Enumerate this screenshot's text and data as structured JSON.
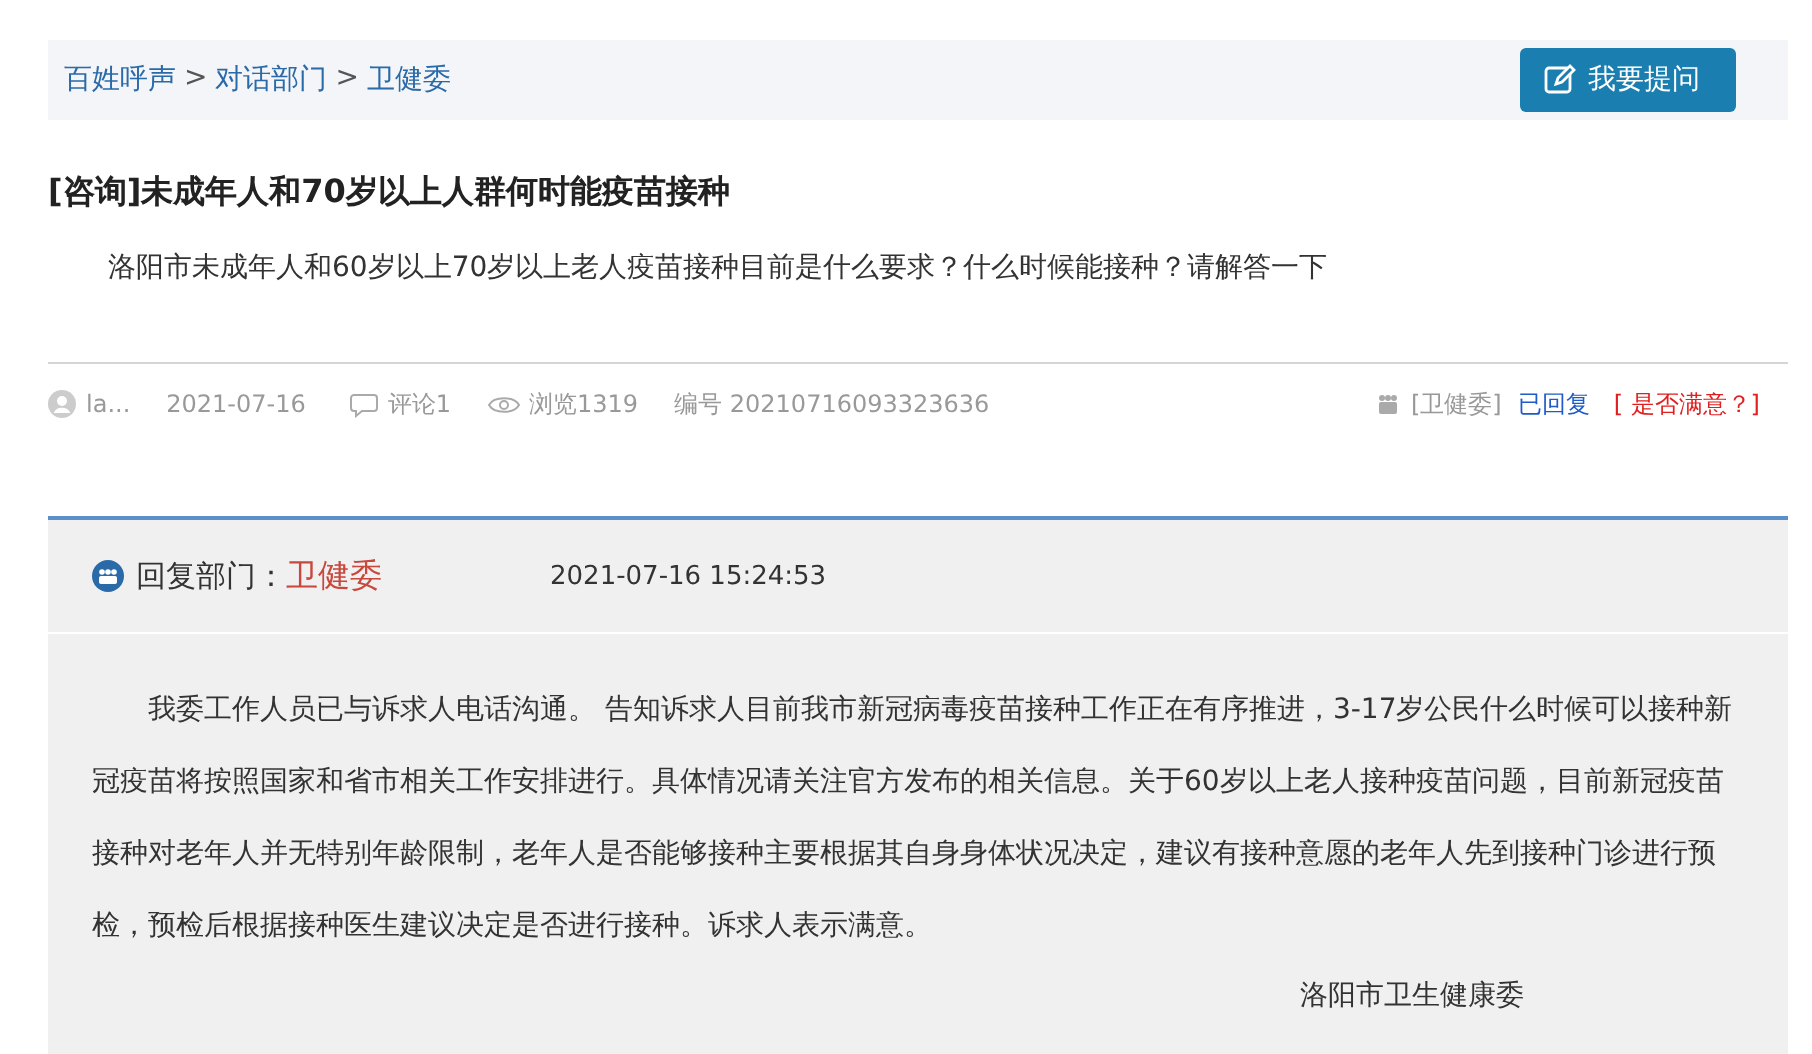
{
  "breadcrumb": {
    "items": [
      "百姓呼声",
      "对话部门",
      "卫健委"
    ],
    "separator": ">"
  },
  "ask_button": {
    "label": "我要提问"
  },
  "question": {
    "title": "[咨询]未成年人和70岁以上人群何时能疫苗接种",
    "body": "洛阳市未成年人和60岁以上70岁以上老人疫苗接种目前是什么要求？什么时候能接种？请解答一下"
  },
  "meta": {
    "user": "la...",
    "date": "2021-07-16",
    "comments": "评论1",
    "views": "浏览1319",
    "number": "编号 20210716093323636",
    "department": "[卫健委]",
    "status": "已回复",
    "satisfaction": "[ 是否满意？]"
  },
  "reply": {
    "label": "回复部门：",
    "department": "卫健委",
    "time": "2021-07-16 15:24:53",
    "body": "我委工作人员已与诉求人电话沟通。 告知诉求人目前我市新冠病毒疫苗接种工作正在有序推进，3-17岁公民什么时候可以接种新冠疫苗将按照国家和省市相关工作安排进行。具体情况请关注官方发布的相关信息。关于60岁以上老人接种疫苗问题，目前新冠疫苗接种对老年人并无特别年龄限制，老年人是否能够接种主要根据其自身身体状况决定，建议有接种意愿的老年人先到接种门诊进行预检，预检后根据接种医生建议决定是否进行接种。诉求人表示满意。",
    "signature": "洛阳市卫生健康委"
  }
}
